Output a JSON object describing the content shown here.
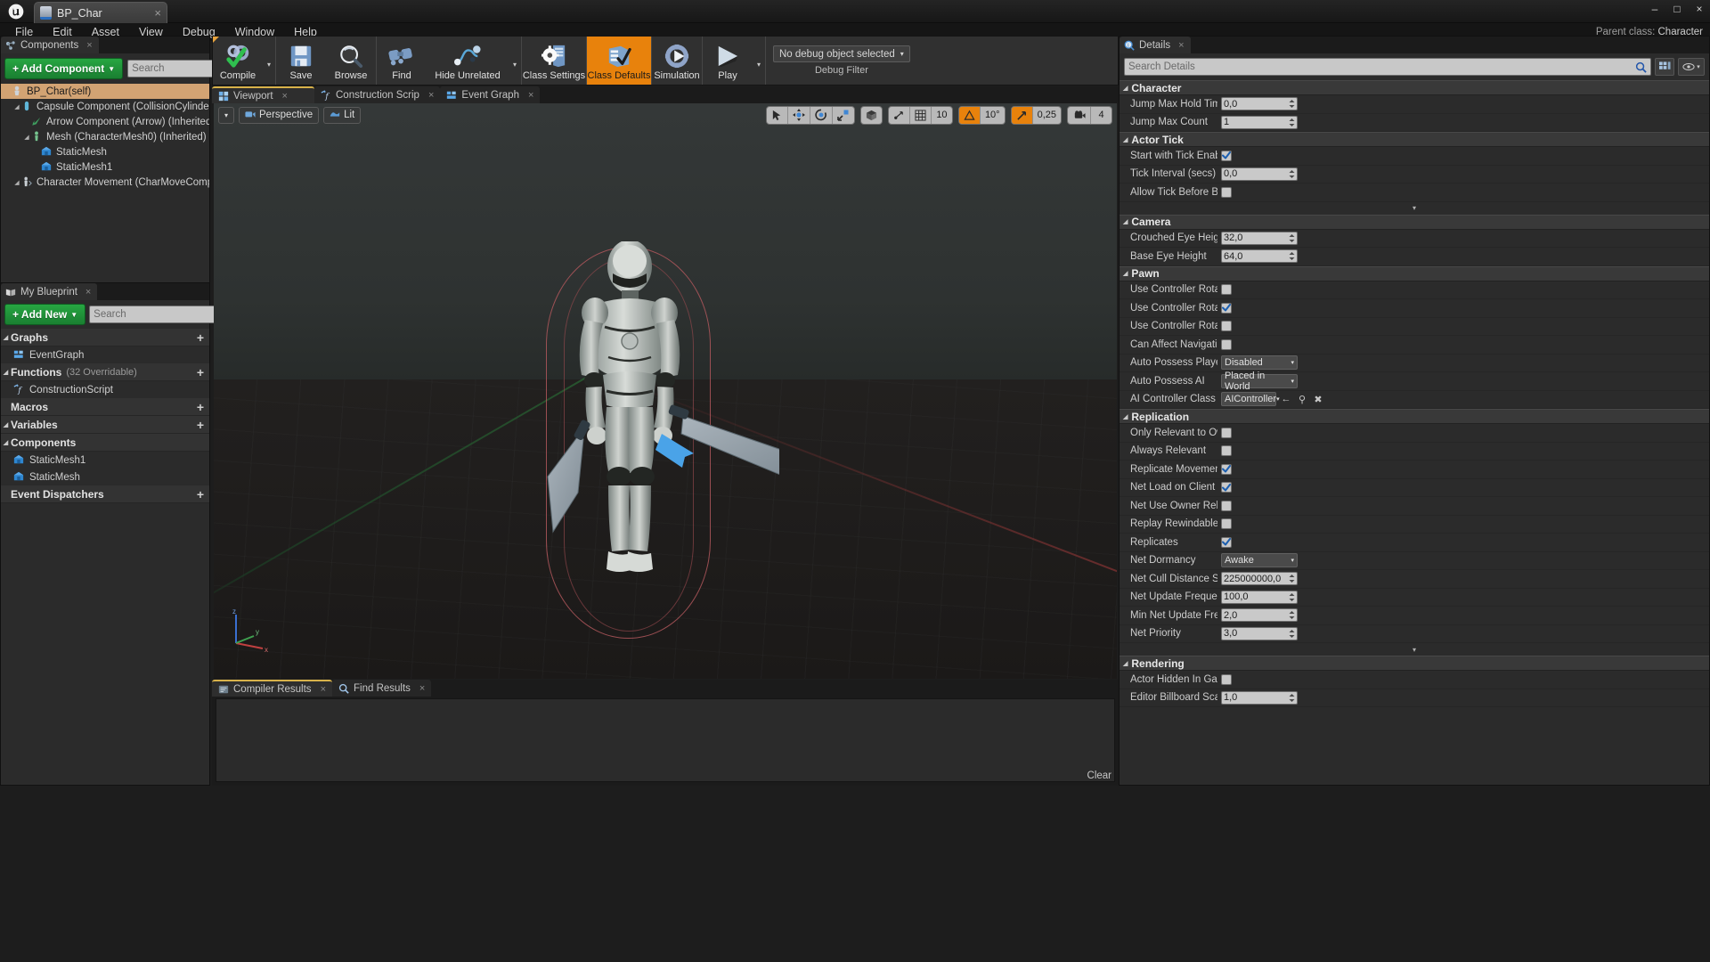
{
  "window": {
    "title": "BP_Char",
    "logo": "unreal-logo",
    "tab_close": "×",
    "minimize": "–",
    "maximize": "□",
    "close": "×"
  },
  "menu": {
    "items": [
      "File",
      "Edit",
      "Asset",
      "View",
      "Debug",
      "Window",
      "Help"
    ]
  },
  "parent_class": {
    "label": "Parent class:",
    "value": "Character"
  },
  "components_panel": {
    "tab_label": "Components",
    "add_button": "+ Add Component",
    "add_caret": "▼",
    "search_placeholder": "Search",
    "tree": [
      {
        "label": "BP_Char(self)",
        "depth": 0,
        "arrow": "",
        "icon": "pawn-icon",
        "selected": true
      },
      {
        "label": "Capsule Component (CollisionCylinder) (Inherited)",
        "depth": 1,
        "arrow": "◢",
        "icon": "capsule-icon",
        "selected": false
      },
      {
        "label": "Arrow Component (Arrow) (Inherited)",
        "depth": 2,
        "arrow": "",
        "icon": "arrow-icon",
        "selected": false
      },
      {
        "label": "Mesh (CharacterMesh0) (Inherited)",
        "depth": 2,
        "arrow": "◢",
        "icon": "skeletal-mesh-icon",
        "selected": false
      },
      {
        "label": "StaticMesh",
        "depth": 3,
        "arrow": "",
        "icon": "static-mesh-icon",
        "selected": false
      },
      {
        "label": "StaticMesh1",
        "depth": 3,
        "arrow": "",
        "icon": "static-mesh-icon",
        "selected": false
      },
      {
        "label": "Character Movement (CharMoveComp) (Inherited)",
        "depth": 1,
        "arrow": "◢",
        "icon": "movement-icon",
        "selected": false
      }
    ]
  },
  "my_blueprint": {
    "tab_label": "My Blueprint",
    "add_button": "+ Add New",
    "add_caret": "▼",
    "search_placeholder": "Search",
    "eye_caret": "▼",
    "sections": [
      {
        "title": "Graphs",
        "count": "",
        "collapsible": true,
        "plus": "+",
        "items": [
          {
            "label": "EventGraph",
            "icon": "event-graph-icon"
          }
        ]
      },
      {
        "title": "Functions",
        "count": "(32 Overridable)",
        "collapsible": true,
        "plus": "+",
        "items": [
          {
            "label": "ConstructionScript",
            "icon": "function-icon"
          }
        ]
      },
      {
        "title": "Macros",
        "count": "",
        "collapsible": false,
        "plus": "+",
        "items": []
      },
      {
        "title": "Variables",
        "count": "",
        "collapsible": true,
        "plus": "+",
        "items": []
      },
      {
        "title": "Components",
        "count": "",
        "collapsible": true,
        "plus": "",
        "items": [
          {
            "label": "StaticMesh1",
            "icon": "static-mesh-icon"
          },
          {
            "label": "StaticMesh",
            "icon": "static-mesh-icon"
          }
        ]
      },
      {
        "title": "Event Dispatchers",
        "count": "",
        "collapsible": false,
        "plus": "+",
        "items": []
      }
    ]
  },
  "toolbar": {
    "buttons": [
      {
        "label": "Compile",
        "icon": "compile-icon",
        "caret": true,
        "active": false,
        "corner": true
      },
      {
        "label": "Save",
        "icon": "save-icon",
        "caret": false,
        "active": false
      },
      {
        "label": "Browse",
        "icon": "browse-icon",
        "caret": false,
        "active": false
      },
      {
        "label": "Find",
        "icon": "find-icon",
        "caret": false,
        "active": false
      },
      {
        "label": "Hide Unrelated",
        "icon": "hide-unrelated-icon",
        "caret": true,
        "active": false
      },
      {
        "label": "Class Settings",
        "icon": "class-settings-icon",
        "caret": false,
        "active": false
      },
      {
        "label": "Class Defaults",
        "icon": "class-defaults-icon",
        "caret": false,
        "active": true
      },
      {
        "label": "Simulation",
        "icon": "simulation-icon",
        "caret": false,
        "active": false
      },
      {
        "label": "Play",
        "icon": "play-icon",
        "caret": true,
        "active": false
      }
    ],
    "debug_object": "No debug object selected",
    "debug_caret": "▾",
    "debug_filter_label": "Debug Filter"
  },
  "graph_tabs": [
    {
      "label": "Viewport",
      "icon": "viewport-icon",
      "active": true,
      "close": "×"
    },
    {
      "label": "Construction Scrip",
      "icon": "function-icon",
      "active": false,
      "close": "×"
    },
    {
      "label": "Event Graph",
      "icon": "event-graph-icon",
      "active": false,
      "close": "×"
    }
  ],
  "viewport": {
    "view_caret": "▾",
    "perspective_label": "Perspective",
    "perspective_icon": "camera-icon",
    "lit_label": "Lit",
    "lit_icon": "lit-icon",
    "gizmo_buttons": [
      {
        "icon": "select-icon",
        "active": false
      },
      {
        "icon": "translate-icon",
        "active": false
      },
      {
        "icon": "rotate-icon",
        "active": false
      },
      {
        "icon": "scale-icon",
        "active": false
      }
    ],
    "coord_icon": "world-coords-icon",
    "grid_snap": {
      "icon": "grid-snap-icon",
      "value": "10",
      "active": false
    },
    "angle_snap": {
      "icon": "angle-snap-icon",
      "value": "10°",
      "active": true
    },
    "scale_snap": {
      "icon": "scale-snap-icon",
      "value": "0,25",
      "active": true
    },
    "camera_speed": {
      "icon": "camera-speed-icon",
      "value": "4"
    },
    "axis_labels": {
      "x": "x",
      "y": "y",
      "z": "z"
    }
  },
  "results_panel": {
    "tabs": [
      {
        "label": "Compiler Results",
        "icon": "compiler-results-icon",
        "active": true,
        "close": "×"
      },
      {
        "label": "Find Results",
        "icon": "find-results-icon",
        "active": false,
        "close": "×"
      }
    ],
    "clear_label": "Clear",
    "body_text": ""
  },
  "details": {
    "tab_label": "Details",
    "tab_icon": "details-icon",
    "tab_close": "×",
    "search_placeholder": "Search Details",
    "search_icon": "search-icon",
    "grid_view_icon": "grid-view-icon",
    "eye_icon": "eye-icon",
    "settings_caret": "▾",
    "categories": [
      {
        "name": "Character",
        "rows": [
          {
            "label": "Jump Max Hold Time",
            "type": "number",
            "value": "0,0"
          },
          {
            "label": "Jump Max Count",
            "type": "number",
            "value": "1"
          }
        ],
        "more": false
      },
      {
        "name": "Actor Tick",
        "rows": [
          {
            "label": "Start with Tick Enabled",
            "type": "checkbox",
            "value": true
          },
          {
            "label": "Tick Interval (secs)",
            "type": "number",
            "value": "0,0"
          },
          {
            "label": "Allow Tick Before Begin Play",
            "type": "checkbox",
            "value": false
          }
        ],
        "more": true
      },
      {
        "name": "Camera",
        "rows": [
          {
            "label": "Crouched Eye Height",
            "type": "number",
            "value": "32,0"
          },
          {
            "label": "Base Eye Height",
            "type": "number",
            "value": "64,0"
          }
        ],
        "more": false
      },
      {
        "name": "Pawn",
        "rows": [
          {
            "label": "Use Controller Rotation Pitch",
            "type": "checkbox",
            "value": false
          },
          {
            "label": "Use Controller Rotation Yaw",
            "type": "checkbox",
            "value": true
          },
          {
            "label": "Use Controller Rotation Roll",
            "type": "checkbox",
            "value": false
          },
          {
            "label": "Can Affect Navigation Generation",
            "type": "checkbox",
            "value": false
          },
          {
            "label": "Auto Possess Player",
            "type": "select",
            "value": "Disabled"
          },
          {
            "label": "Auto Possess AI",
            "type": "select",
            "value": "Placed in World"
          },
          {
            "label": "AI Controller Class",
            "type": "asset",
            "value": "AIController"
          }
        ],
        "more": false
      },
      {
        "name": "Replication",
        "rows": [
          {
            "label": "Only Relevant to Owner",
            "type": "checkbox",
            "value": false
          },
          {
            "label": "Always Relevant",
            "type": "checkbox",
            "value": false
          },
          {
            "label": "Replicate Movement",
            "type": "checkbox",
            "value": true
          },
          {
            "label": "Net Load on Client",
            "type": "checkbox",
            "value": true
          },
          {
            "label": "Net Use Owner Relevancy",
            "type": "checkbox",
            "value": false
          },
          {
            "label": "Replay Rewindable",
            "type": "checkbox",
            "value": false
          },
          {
            "label": "Replicates",
            "type": "checkbox",
            "value": true
          },
          {
            "label": "Net Dormancy",
            "type": "select",
            "value": "Awake"
          },
          {
            "label": "Net Cull Distance Squared",
            "type": "number",
            "value": "225000000,0"
          },
          {
            "label": "Net Update Frequency",
            "type": "number",
            "value": "100,0"
          },
          {
            "label": "Min Net Update Frequency",
            "type": "number",
            "value": "2,0"
          },
          {
            "label": "Net Priority",
            "type": "number",
            "value": "3,0"
          }
        ],
        "more": true
      },
      {
        "name": "Rendering",
        "rows": [
          {
            "label": "Actor Hidden In Game",
            "type": "checkbox",
            "value": false
          },
          {
            "label": "Editor Billboard Scale",
            "type": "number",
            "value": "1,0"
          }
        ],
        "more": false
      }
    ]
  },
  "colors": {
    "accent_orange": "#e8820c",
    "green_button": "#27a642",
    "selection_tan": "#d2a373",
    "panel_bg": "#2b2b2b",
    "tab_active_underline": "#d8b24a"
  }
}
